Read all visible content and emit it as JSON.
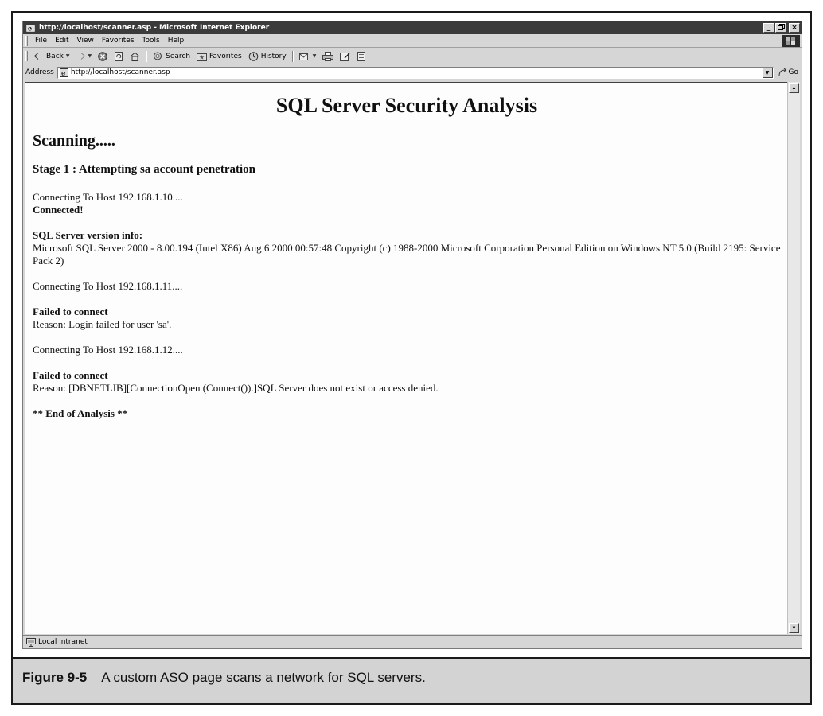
{
  "window": {
    "title": "http://localhost/scanner.asp - Microsoft Internet Explorer",
    "controls": {
      "minimize": "_",
      "maximize": "▫",
      "close": "×"
    }
  },
  "menu": [
    "File",
    "Edit",
    "View",
    "Favorites",
    "Tools",
    "Help"
  ],
  "toolbar": {
    "back": "Back",
    "search": "Search",
    "favorites": "Favorites",
    "history": "History"
  },
  "address": {
    "label": "Address",
    "url": "http://localhost/scanner.asp",
    "go": "Go"
  },
  "page": {
    "title": "SQL Server Security Analysis",
    "status_heading": "Scanning.....",
    "stage": "Stage 1 : Attempting sa account penetration",
    "host1": {
      "connecting": "Connecting To Host 192.168.1.10....",
      "result": "Connected!",
      "version_label": "SQL Server version info:",
      "version_text": "Microsoft SQL Server 2000 - 8.00.194 (Intel X86) Aug 6 2000 00:57:48 Copyright (c) 1988-2000 Microsoft Corporation Personal Edition on Windows NT 5.0 (Build 2195: Service Pack 2)"
    },
    "host2": {
      "connecting": "Connecting To Host 192.168.1.11....",
      "result": "Failed to connect",
      "reason": "Reason: Login failed for user 'sa'."
    },
    "host3": {
      "connecting": "Connecting To Host 192.168.1.12....",
      "result": "Failed to connect",
      "reason": "Reason: [DBNETLIB][ConnectionOpen (Connect()).]SQL Server does not exist or access denied."
    },
    "footer": "** End of Analysis **"
  },
  "status": {
    "zone": "Local intranet"
  },
  "caption": {
    "label": "Figure 9-5",
    "text": "A custom ASO page scans a network for SQL servers."
  }
}
